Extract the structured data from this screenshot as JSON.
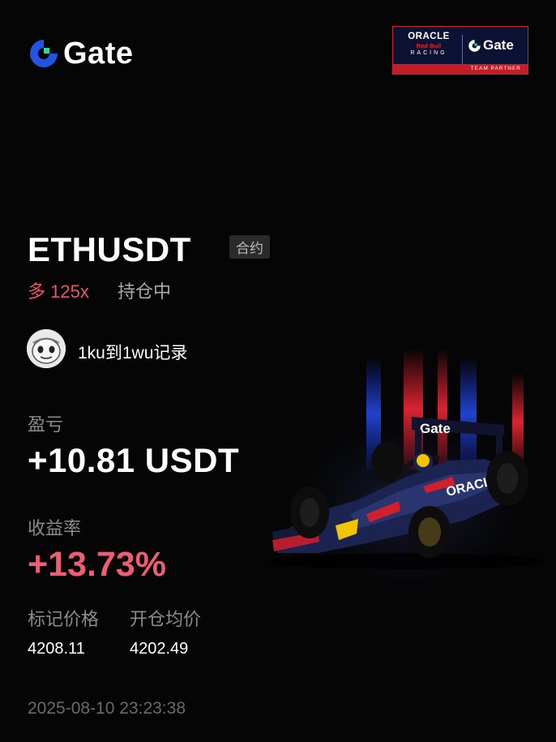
{
  "header": {
    "brand_text": "Gate",
    "partner_badge": {
      "oracle": "ORACLE",
      "redbull": "Red Bull",
      "racing": "RACING",
      "gate": "Gate",
      "team_partner": "TEAM PARTNER"
    }
  },
  "position": {
    "symbol": "ETHUSDT",
    "type_tag": "合约",
    "side_leverage": "多 125x",
    "status": "持仓中"
  },
  "user": {
    "name": "1ku到1wu记录"
  },
  "stats": {
    "pnl_label": "盈亏",
    "pnl_value": "+10.81 USDT",
    "roi_label": "收益率",
    "roi_value": "+13.73%",
    "mark_price_label": "标记价格",
    "mark_price_value": "4208.11",
    "entry_price_label": "开仓均价",
    "entry_price_value": "4202.49"
  },
  "timestamp": "2025-08-10 23:23:38",
  "car": {
    "wing_text": "Gate",
    "sidepod_text": "ORACLE"
  },
  "colors": {
    "background": "#050505",
    "brand_blue": "#2354e6",
    "brand_green": "#17e5a2",
    "profit_red": "#ef5c74",
    "muted_text": "#8c8c8c"
  }
}
